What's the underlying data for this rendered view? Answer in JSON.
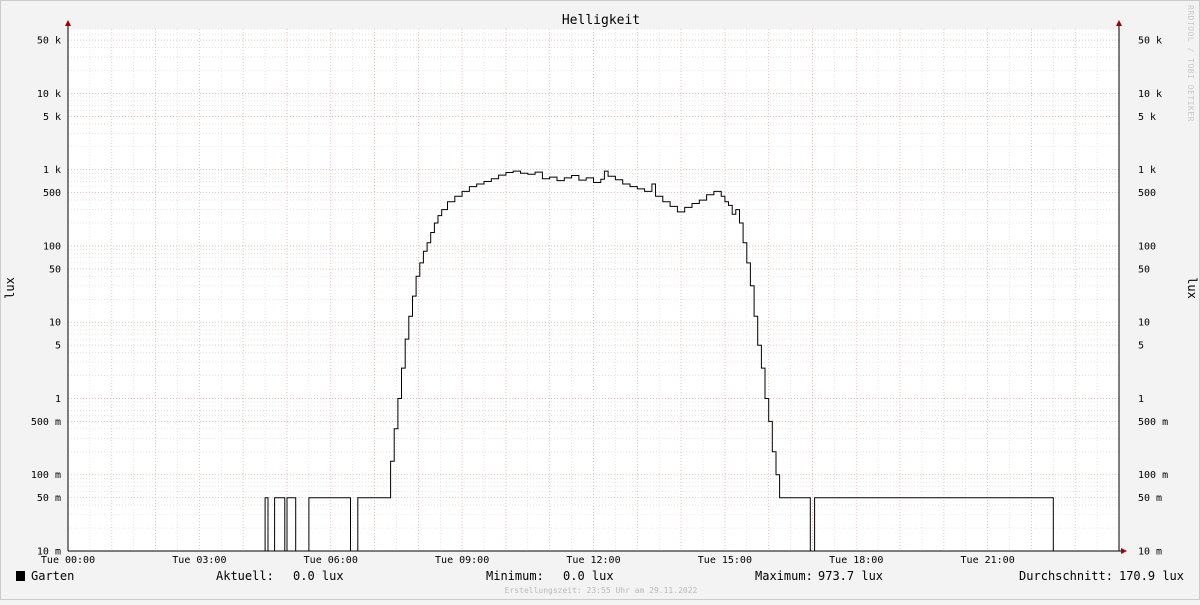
{
  "chart_data": {
    "type": "line",
    "title": "Helligkeit",
    "ylabel_left": "lux",
    "ylabel_right": "lux",
    "yscale": "log",
    "ylim": [
      0.01,
      70000
    ],
    "xlim": [
      "00:00",
      "24:00"
    ],
    "y_ticks": [
      {
        "v": 50000,
        "label": "50 k"
      },
      {
        "v": 10000,
        "label": "10 k"
      },
      {
        "v": 5000,
        "label": "5 k"
      },
      {
        "v": 1000,
        "label": "1 k"
      },
      {
        "v": 500,
        "label": "500"
      },
      {
        "v": 100,
        "label": "100"
      },
      {
        "v": 50,
        "label": "50"
      },
      {
        "v": 10,
        "label": "10"
      },
      {
        "v": 5,
        "label": "5"
      },
      {
        "v": 1,
        "label": "1"
      },
      {
        "v": 0.5,
        "label": "500 m"
      },
      {
        "v": 0.1,
        "label": "100 m"
      },
      {
        "v": 0.05,
        "label": "50 m"
      },
      {
        "v": 0.01,
        "label": "10 m"
      }
    ],
    "x_ticks": [
      {
        "h": 0,
        "label": "Tue 00:00"
      },
      {
        "h": 3,
        "label": "Tue 03:00"
      },
      {
        "h": 6,
        "label": "Tue 06:00"
      },
      {
        "h": 9,
        "label": "Tue 09:00"
      },
      {
        "h": 12,
        "label": "Tue 12:00"
      },
      {
        "h": 15,
        "label": "Tue 15:00"
      },
      {
        "h": 18,
        "label": "Tue 18:00"
      },
      {
        "h": 21,
        "label": "Tue 21:00"
      }
    ],
    "series": [
      {
        "name": "Garten",
        "color": "#000000",
        "points": [
          [
            "00:00",
            0.01
          ],
          [
            "04:29",
            0.01
          ],
          [
            "04:30",
            0.05
          ],
          [
            "04:34",
            0.01
          ],
          [
            "04:43",
            0.05
          ],
          [
            "04:57",
            0.01
          ],
          [
            "05:00",
            0.05
          ],
          [
            "05:12",
            0.01
          ],
          [
            "05:30",
            0.05
          ],
          [
            "06:27",
            0.01
          ],
          [
            "06:37",
            0.05
          ],
          [
            "07:20",
            0.05
          ],
          [
            "07:22",
            0.15
          ],
          [
            "07:27",
            0.4
          ],
          [
            "07:32",
            1.0
          ],
          [
            "07:37",
            2.5
          ],
          [
            "07:42",
            6
          ],
          [
            "07:47",
            12
          ],
          [
            "07:52",
            22
          ],
          [
            "07:57",
            40
          ],
          [
            "08:02",
            60
          ],
          [
            "08:07",
            85
          ],
          [
            "08:12",
            110
          ],
          [
            "08:17",
            150
          ],
          [
            "08:22",
            200
          ],
          [
            "08:27",
            250
          ],
          [
            "08:32",
            300
          ],
          [
            "08:40",
            380
          ],
          [
            "08:50",
            450
          ],
          [
            "09:00",
            520
          ],
          [
            "09:10",
            600
          ],
          [
            "09:20",
            650
          ],
          [
            "09:30",
            700
          ],
          [
            "09:40",
            760
          ],
          [
            "09:50",
            850
          ],
          [
            "10:00",
            920
          ],
          [
            "10:10",
            960
          ],
          [
            "10:20",
            900
          ],
          [
            "10:30",
            870
          ],
          [
            "10:40",
            930
          ],
          [
            "10:50",
            760
          ],
          [
            "11:00",
            800
          ],
          [
            "11:10",
            720
          ],
          [
            "11:20",
            780
          ],
          [
            "11:30",
            840
          ],
          [
            "11:40",
            730
          ],
          [
            "11:50",
            780
          ],
          [
            "12:00",
            680
          ],
          [
            "12:10",
            750
          ],
          [
            "12:15",
            960
          ],
          [
            "12:20",
            820
          ],
          [
            "12:30",
            740
          ],
          [
            "12:40",
            650
          ],
          [
            "12:50",
            600
          ],
          [
            "13:00",
            560
          ],
          [
            "13:10",
            520
          ],
          [
            "13:20",
            650
          ],
          [
            "13:25",
            450
          ],
          [
            "13:35",
            380
          ],
          [
            "13:45",
            330
          ],
          [
            "13:55",
            280
          ],
          [
            "14:05",
            320
          ],
          [
            "14:15",
            360
          ],
          [
            "14:25",
            400
          ],
          [
            "14:35",
            470
          ],
          [
            "14:45",
            520
          ],
          [
            "14:55",
            450
          ],
          [
            "15:00",
            380
          ],
          [
            "15:05",
            340
          ],
          [
            "15:10",
            260
          ],
          [
            "15:15",
            300
          ],
          [
            "15:20",
            200
          ],
          [
            "15:25",
            110
          ],
          [
            "15:30",
            60
          ],
          [
            "15:35",
            30
          ],
          [
            "15:40",
            12
          ],
          [
            "15:45",
            5
          ],
          [
            "15:50",
            2.5
          ],
          [
            "15:55",
            1.0
          ],
          [
            "16:00",
            0.5
          ],
          [
            "16:05",
            0.2
          ],
          [
            "16:10",
            0.1
          ],
          [
            "16:15",
            0.05
          ],
          [
            "16:55",
            0.05
          ],
          [
            "16:57",
            0.01
          ],
          [
            "17:03",
            0.05
          ],
          [
            "22:29",
            0.05
          ],
          [
            "22:30",
            0.01
          ],
          [
            "24:00",
            0.01
          ]
        ]
      }
    ],
    "grid": true,
    "legend_position": "bottom-left"
  },
  "legend": {
    "series_name": "Garten",
    "aktuell_label": "Aktuell:",
    "aktuell_value": "0.0 lux",
    "minimum_label": "Minimum:",
    "minimum_value": "0.0 lux",
    "maximum_label": "Maximum:",
    "maximum_value": "973.7 lux",
    "durchschnitt_label": "Durchschnitt:",
    "durchschnitt_value": "170.9 lux"
  },
  "footer_text": "Erstellungszeit: 23:55 Uhr am 29.11.2022",
  "watermark_text": "RRDTOOL / TOBI OETIKER",
  "colors": {
    "background": "#f3f3f3",
    "plot_background": "#ffffff",
    "minor_grid": "#cfcfcf",
    "major_grid": "#e8b4b4",
    "axis": "#7a0000",
    "line": "#000000"
  }
}
